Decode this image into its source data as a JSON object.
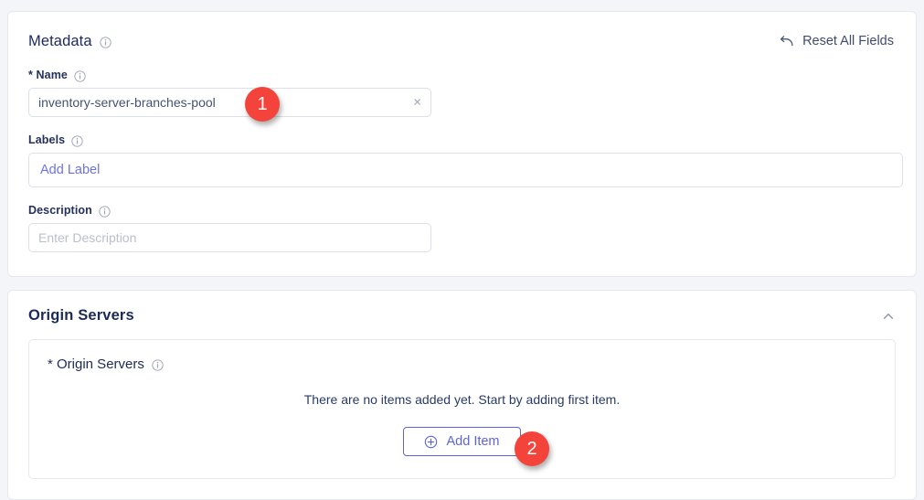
{
  "metadata": {
    "title": "Metadata",
    "title_info_icon": "info-icon",
    "reset": {
      "label": "Reset All Fields",
      "icon": "reset-arrow-icon"
    },
    "fields": {
      "name": {
        "label": "* Name",
        "info_icon": "info-icon",
        "value": "inventory-server-branches-pool",
        "clear_icon": "×"
      },
      "labels": {
        "label": "Labels",
        "info_icon": "info-icon",
        "placeholder": "Add Label"
      },
      "description": {
        "label": "Description",
        "info_icon": "info-icon",
        "value": "",
        "placeholder": "Enter Description"
      }
    }
  },
  "origin_servers": {
    "title": "Origin Servers",
    "collapse_icon": "chevron-up-icon",
    "inner": {
      "label": "* Origin Servers",
      "info_icon": "info-icon",
      "empty_text": "There are no items added yet. Start by adding first item.",
      "add_item": {
        "label": "Add Item",
        "icon": "plus-circle-icon"
      }
    }
  },
  "markers": [
    {
      "number": "1"
    },
    {
      "number": "2"
    }
  ],
  "colors": {
    "page_background": "#f4f5f9",
    "card_background": "#ffffff",
    "heading": "#1b2a58",
    "accent_indigo": "#5b63e0",
    "link_purple": "#6a73e8",
    "marker_red": "#f4433b",
    "border": "#e6e8ef",
    "input_border": "#dcdfe8",
    "placeholder": "#b9bfcd"
  }
}
